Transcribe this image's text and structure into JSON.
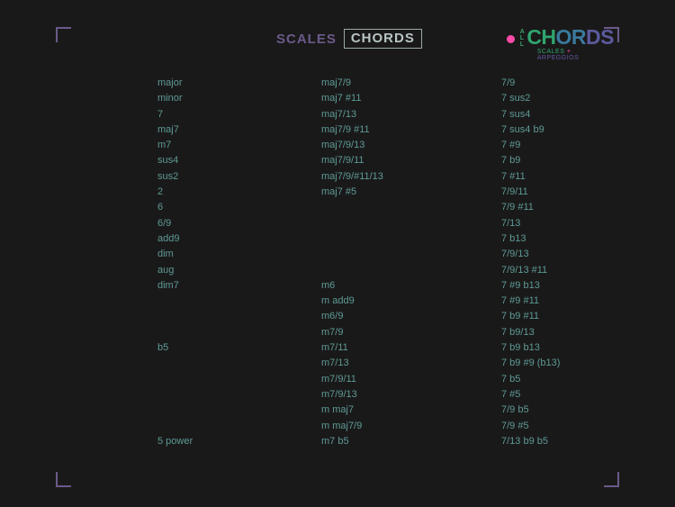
{
  "tabs": {
    "scales": "SCALES",
    "chords": "CHORDS"
  },
  "logo": {
    "all_v": [
      "A",
      "L",
      "L"
    ],
    "main_part1": "CH",
    "main_part2": "OR",
    "main_part3": "DS",
    "sub_scales": "SCALES",
    "sub_plus": "+",
    "sub_arp": "ARPEGGIOS"
  },
  "columns": {
    "col1": [
      "major",
      "minor",
      "7",
      "maj7",
      "m7",
      "sus4",
      "sus2",
      "2",
      "6",
      "6/9",
      "add9",
      "dim",
      "aug",
      "dim7",
      "",
      "",
      "",
      "b5",
      "",
      "",
      "",
      "",
      "",
      "5 power"
    ],
    "col2": [
      "maj7/9",
      "maj7 #11",
      "maj7/13",
      "maj7/9 #11",
      "maj7/9/13",
      "maj7/9/11",
      "maj7/9/#11/13",
      "maj7 #5",
      "",
      "",
      "",
      "",
      "",
      "m6",
      "m add9",
      "m6/9",
      "m7/9",
      "m7/11",
      "m7/13",
      "m7/9/11",
      "m7/9/13",
      "m maj7",
      "m maj7/9",
      "m7 b5"
    ],
    "col3": [
      "7/9",
      "7 sus2",
      "7 sus4",
      "7 sus4 b9",
      "7 #9",
      "7 b9",
      "7 #11",
      "7/9/11",
      "7/9 #11",
      "7/13",
      "7 b13",
      "7/9/13",
      "7/9/13 #11",
      "7 #9 b13",
      "7 #9 #11",
      "7 b9 #11",
      "7 b9/13",
      "7 b9 b13",
      "7 b9 #9 (b13)",
      "7 b5",
      "7 #5",
      "7/9 b5",
      "7/9 #5",
      "7/13 b9 b5"
    ]
  }
}
